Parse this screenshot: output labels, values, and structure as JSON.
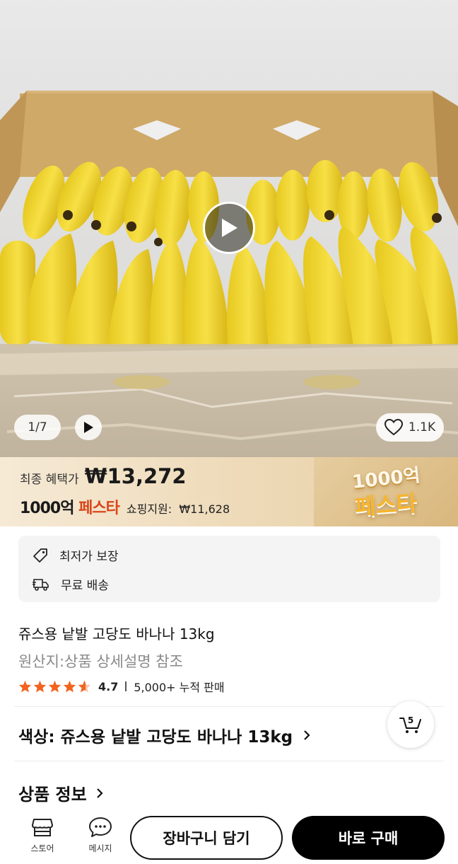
{
  "hero": {
    "image_alt": "banana-box-photo",
    "counter": "1/7",
    "likes": "1.1K"
  },
  "banner": {
    "final_label": "최종 혜택가",
    "final_price": "₩13,272",
    "fest_number": "1000억",
    "fest_word": "페스타",
    "support_label": "쇼핑지원:",
    "support_price": "₩11,628",
    "logo_top": "1000억",
    "logo_bottom": "페스타"
  },
  "benefits": [
    {
      "icon": "price-tag-icon",
      "label": "최저가 보장"
    },
    {
      "icon": "delivery-truck-icon",
      "label": "무료 배송"
    }
  ],
  "product": {
    "title": "쥬스용 낱발 고당도 바나나 13kg",
    "origin": "원산지:상품 상세설명 참조",
    "rating": "4.7",
    "rating_fraction": 0.94,
    "sales": "5,000+ 누적 판매"
  },
  "option": {
    "label": "색상: 쥬스용 낱발 고당도 바나나 13kg"
  },
  "cart_float": {
    "count": "5"
  },
  "info_section": {
    "label": "상품 정보"
  },
  "bottom_bar": {
    "store_label": "스토어",
    "message_label": "메시지",
    "add_to_cart": "장바구니 담기",
    "buy_now": "바로 구매"
  },
  "colors": {
    "accent_orange": "#d9461b",
    "star": "#f2641e",
    "buy_button": "#000000"
  }
}
